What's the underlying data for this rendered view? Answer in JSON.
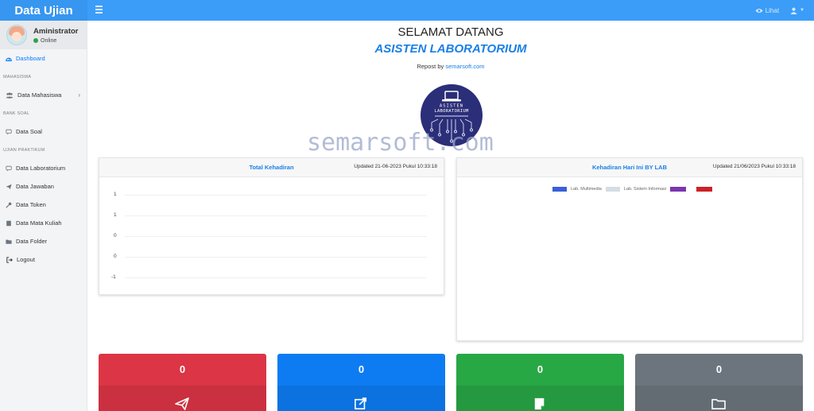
{
  "app": {
    "title": "Data Ujian"
  },
  "topbar": {
    "view_label": "Lihat",
    "colors": {
      "bar": "#3b9df8",
      "brand": "#3796f0"
    }
  },
  "user": {
    "name": "Aministrator",
    "status": "Online"
  },
  "sidebar": {
    "dashboard": "Dashboard",
    "header_mahasiswa": "MAHASISWA",
    "data_mahasiswa": "Data Mahasiswa",
    "header_bank_soal": "BANK SOAL",
    "data_soal": "Data Soal",
    "header_ujian": "UJIAN PRAKTIKUM",
    "data_laboratorium": "Data Laboratorium",
    "data_jawaban": "Data Jawaban",
    "data_token": "Data Token",
    "data_mata_kuliah": "Data Mata Kuliah",
    "data_folder": "Data Folder",
    "logout": "Logout"
  },
  "main": {
    "welcome": "SELAMAT DATANG",
    "subtitle": "ASISTEN LABORATORIUM",
    "repost_prefix": "Repost by",
    "repost_link": "semarsoft.com",
    "watermark": "semarsoft.com",
    "logo_text_line1": "ASISTEN",
    "logo_text_line2": "LABORATORIUM"
  },
  "card_total": {
    "title": "Total Kehadiran",
    "updated": "Updated 21-06-2023 Pukul 10:33:18",
    "y_ticks": [
      "1",
      "1",
      "0",
      "0",
      "-1"
    ]
  },
  "card_lab": {
    "title": "Kehadiran Hari Ini BY LAB",
    "updated": "Updated 21/06/2023 Pukul 10:33:18",
    "legend": [
      {
        "label": "Lab. Multimedia",
        "color": "#3a5fd9"
      },
      {
        "label": "Lab. Sistem Informasi",
        "color": "#d5dde3"
      },
      {
        "label": "",
        "color": "#7b35b0"
      },
      {
        "label": "",
        "color": "#cc2127"
      }
    ]
  },
  "stats": [
    {
      "value": "0",
      "color": "#dc3545",
      "icon": "paper-plane-icon"
    },
    {
      "value": "0",
      "color": "#0d7cf2",
      "icon": "edit-icon"
    },
    {
      "value": "0",
      "color": "#28a745",
      "icon": "note-icon"
    },
    {
      "value": "0",
      "color": "#6c757d",
      "icon": "folder-icon"
    }
  ]
}
